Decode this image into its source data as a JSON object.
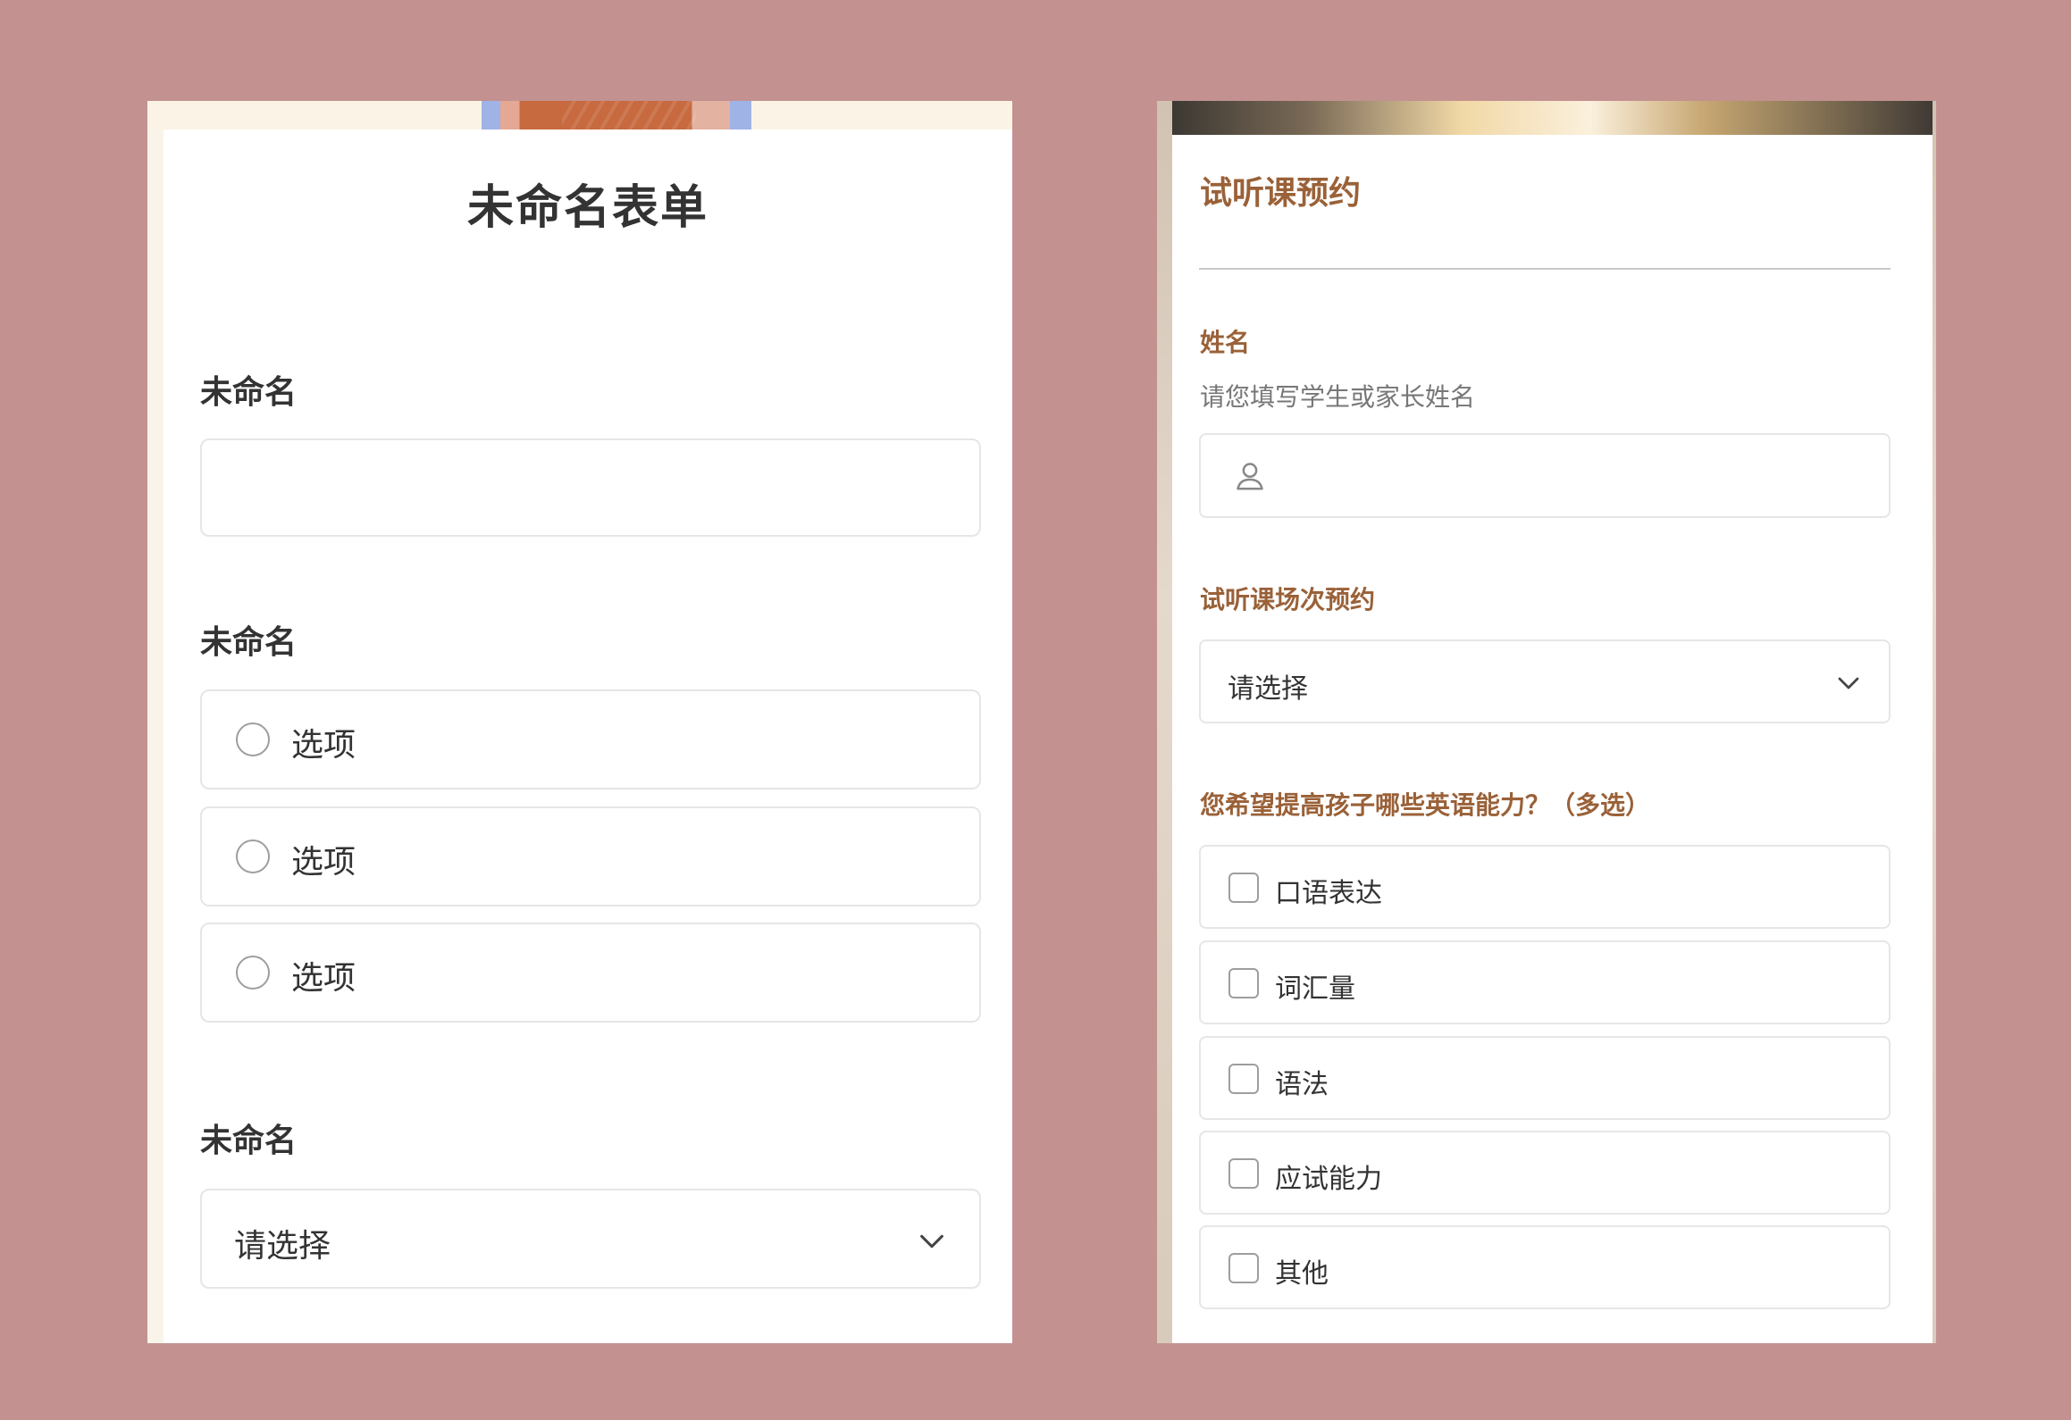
{
  "left_form": {
    "title": "未命名表单",
    "fields": [
      {
        "label": "未命名",
        "type": "text",
        "value": ""
      },
      {
        "label": "未命名",
        "type": "radio",
        "options": [
          "选项",
          "选项",
          "选项"
        ]
      },
      {
        "label": "未命名",
        "type": "select",
        "placeholder": "请选择"
      }
    ]
  },
  "right_form": {
    "title": "试听课预约",
    "name_field": {
      "label": "姓名",
      "hint": "请您填写学生或家长姓名",
      "value": ""
    },
    "session_field": {
      "label": "试听课场次预约",
      "placeholder": "请选择"
    },
    "skills_field": {
      "label": "您希望提高孩子哪些英语能力？（多选）",
      "options": [
        "口语表达",
        "词汇量",
        "语法",
        "应试能力",
        "其他"
      ]
    }
  },
  "colors": {
    "background": "#c29190",
    "right_accent": "#9a6138",
    "border": "#e6e6e6"
  },
  "icons": {
    "select_arrow": "chevron-down-icon",
    "name_input": "user-icon"
  }
}
